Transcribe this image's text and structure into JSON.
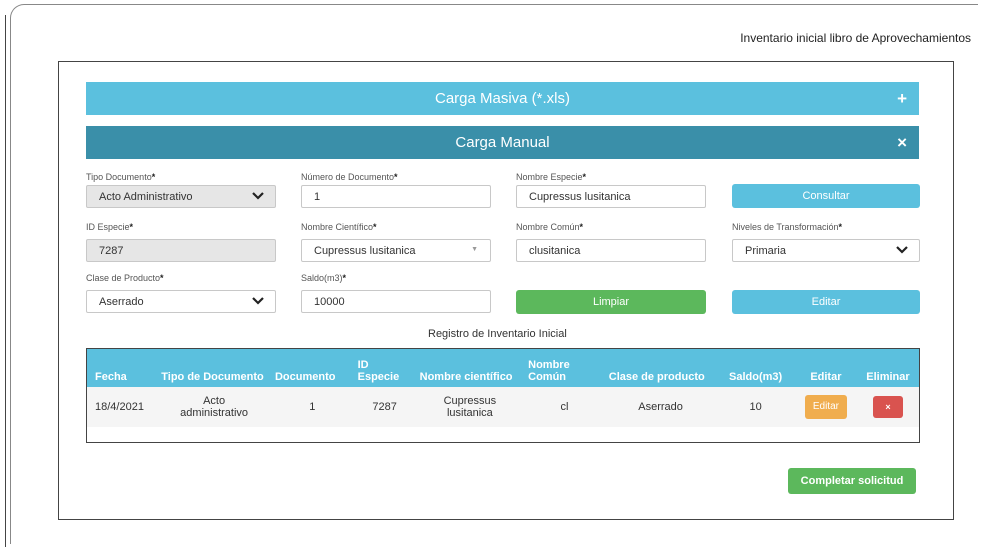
{
  "page": {
    "title": "Inventario inicial libro de Aprovechamientos"
  },
  "accordion": {
    "masiva": {
      "label": "Carga Masiva (*.xls)",
      "icon": "plus-icon",
      "icon_glyph": "+"
    },
    "manual": {
      "label": "Carga Manual",
      "icon": "close-icon",
      "icon_glyph": "×"
    }
  },
  "form": {
    "required_mark": "*",
    "tipo_documento": {
      "label": "Tipo Documento",
      "value": "Acto Administrativo"
    },
    "numero_documento": {
      "label": "Número de Documento",
      "value": "1"
    },
    "nombre_especie": {
      "label": "Nombre Especie",
      "value": "Cupressus lusitanica"
    },
    "id_especie": {
      "label": "ID Especie",
      "value": "7287"
    },
    "nombre_cientifico": {
      "label": "Nombre Científico",
      "value": "Cupressus lusitanica"
    },
    "nombre_comun": {
      "label": "Nombre Común",
      "value": "clusitanica"
    },
    "niveles_transformacion": {
      "label": "Niveles de Transformación",
      "value": "Primaria"
    },
    "clase_producto": {
      "label": "Clase de Producto",
      "value": "Aserrado"
    },
    "saldo": {
      "label": "Saldo(m3)",
      "value": "10000"
    },
    "buttons": {
      "consultar": "Consultar",
      "limpiar": "Limpiar",
      "editar": "Editar"
    }
  },
  "table": {
    "caption": "Registro de Inventario Inicial",
    "headers": [
      "Fecha",
      "Tipo de Documento",
      "Documento",
      "ID Especie",
      "Nombre científico",
      "Nombre Común",
      "Clase de producto",
      "Saldo(m3)",
      "Editar",
      "Eliminar"
    ],
    "rows": [
      {
        "fecha": "18/4/2021",
        "tipo": "Acto administrativo",
        "documento": "1",
        "id": "7287",
        "cientifico": "Cupressus lusitanica",
        "comun": "cl",
        "clase": "Aserrado",
        "saldo": "10",
        "editar": "Editar",
        "eliminar": "×"
      }
    ]
  },
  "footer": {
    "completar": "Completar solicitud"
  },
  "colors": {
    "info": "#5bc0de",
    "manual_bar": "#3a8fa9",
    "success": "#5cb85c",
    "warning": "#f0ad4e",
    "danger": "#d9534f"
  }
}
